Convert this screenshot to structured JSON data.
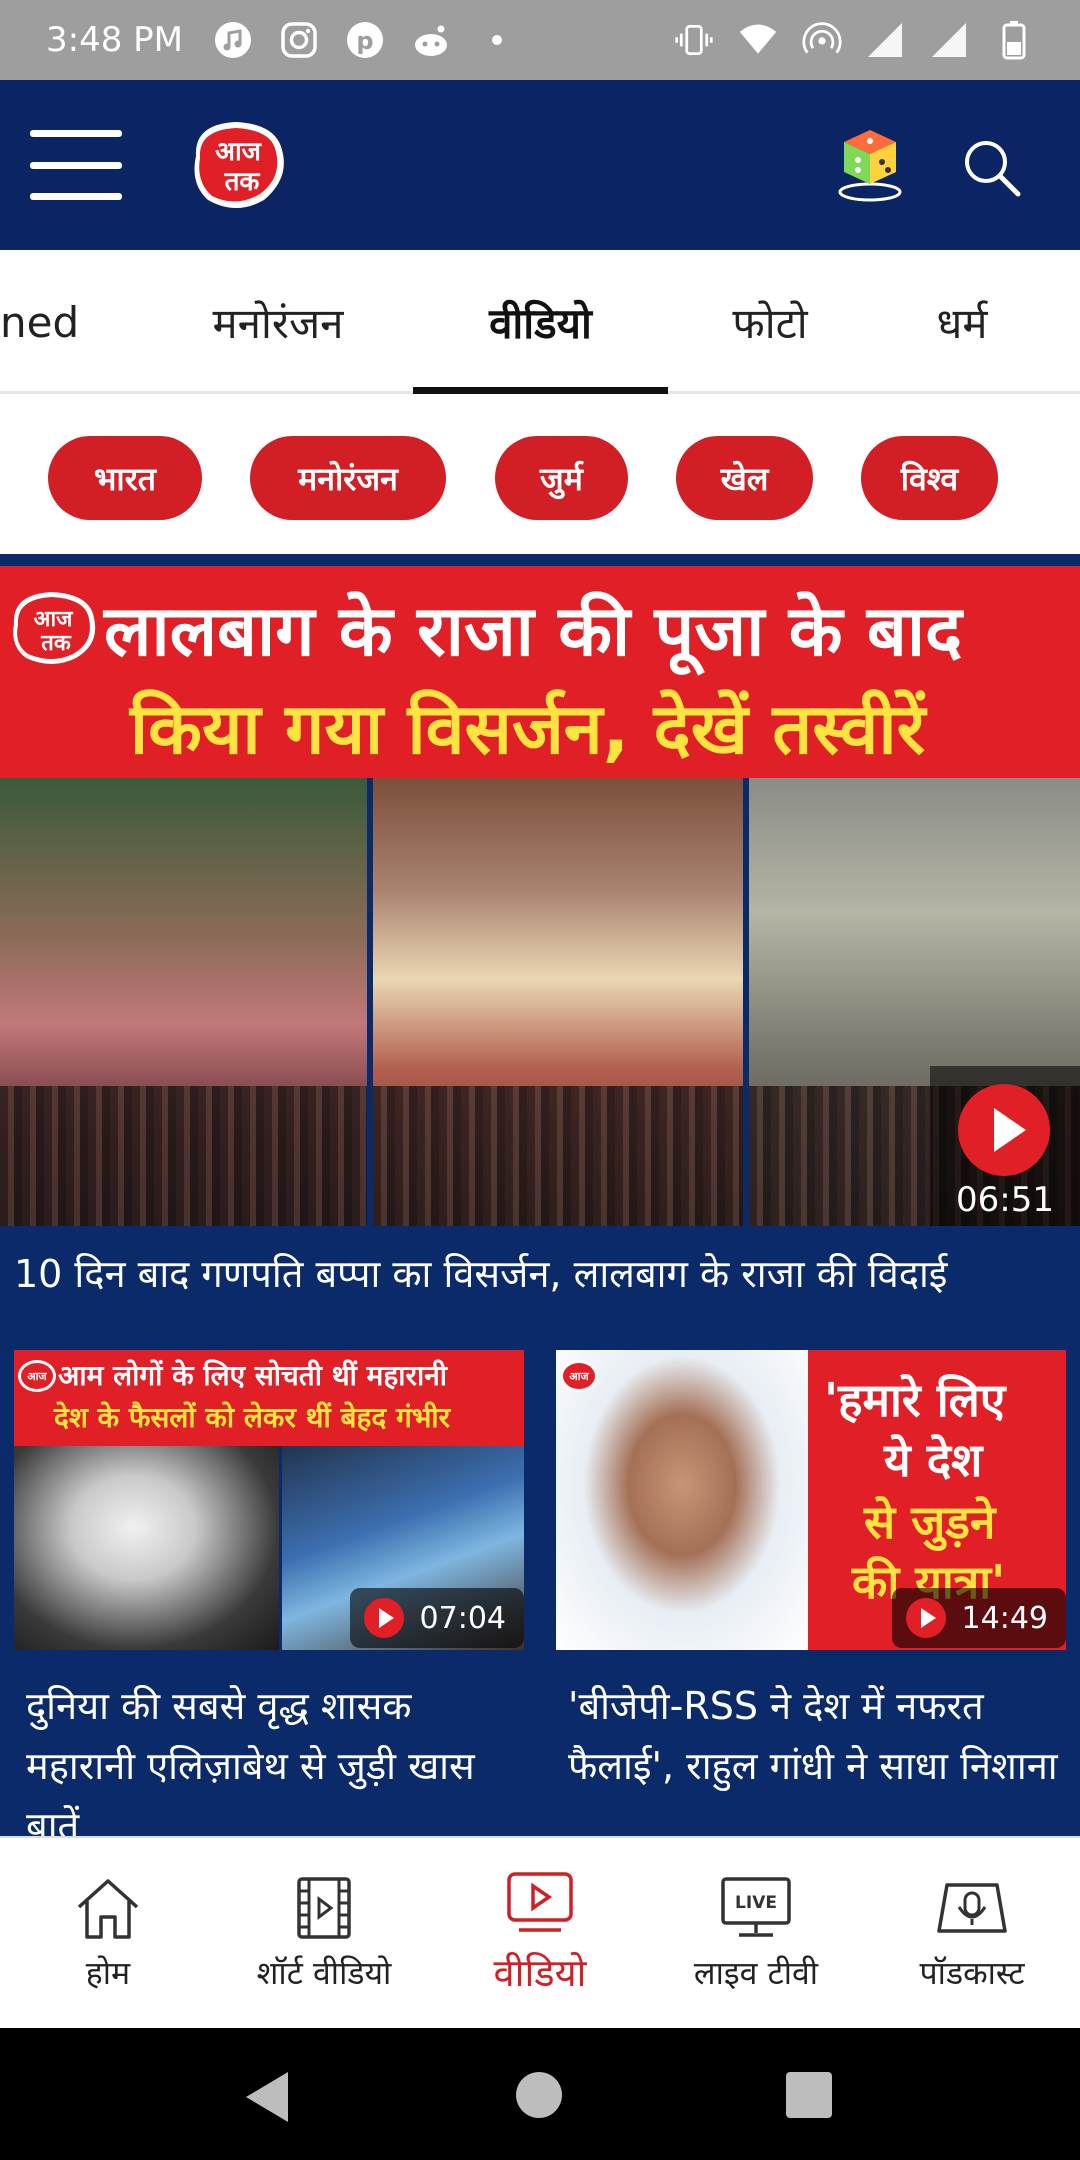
{
  "status_bar": {
    "time": "3:48 PM"
  },
  "header": {
    "logo_text": "आज तक"
  },
  "tabs": [
    {
      "label": "ned"
    },
    {
      "label": "मनोरंजन"
    },
    {
      "label": "वीडियो"
    },
    {
      "label": "फोटो"
    },
    {
      "label": "धर्म"
    }
  ],
  "chips": [
    "भारत",
    "मनोरंजन",
    "जुर्म",
    "खेल",
    "विश्व"
  ],
  "feature": {
    "headline_line1": "लालबाग के राजा की पूजा के बाद",
    "headline_line2": "किया गया विसर्जन, देखें तस्वीरें",
    "duration": "06:51",
    "caption": "10 दिन बाद गणपति बप्पा का विसर्जन, लालबाग के राजा की विदाई"
  },
  "cards": [
    {
      "thumb_line1": "आम लोगों के लिए सोचती थीं महारानी",
      "thumb_line2": "देश के फैसलों को लेकर थीं बेहद गंभीर",
      "duration": "07:04",
      "title": "दुनिया की सबसे वृद्ध शासक महारानी एलिज़ाबेथ से जुड़ी खास बातें"
    },
    {
      "quote_line1": "'हमारे लिए",
      "quote_line2": "ये देश",
      "quote_line3": "से जुड़ने",
      "quote_line4": "की यात्रा'",
      "duration": "14:49",
      "title": "'बीजेपी-RSS ने देश में नफरत फैलाई', राहुल गांधी ने साधा निशाना"
    }
  ],
  "bottom_nav": [
    {
      "label": "होम",
      "icon": "home-icon"
    },
    {
      "label": "शॉर्ट वीडियो",
      "icon": "short-video-icon"
    },
    {
      "label": "वीडियो",
      "icon": "video-icon"
    },
    {
      "label": "लाइव टीवी",
      "icon": "live-tv-icon",
      "badge": "LIVE"
    },
    {
      "label": "पॉडकास्ट",
      "icon": "podcast-icon"
    }
  ],
  "colors": {
    "brand_red": "#d21f26",
    "header_blue": "#0b2463",
    "yellow": "#ffe341"
  }
}
